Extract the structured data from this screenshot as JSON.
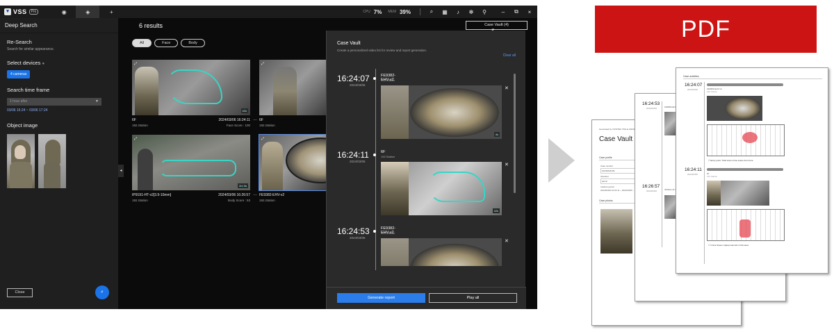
{
  "app": {
    "logo_text": "VSS",
    "pro_badge": "Pro",
    "stats": {
      "cpu_label": "CPU",
      "cpu_value": "7%",
      "mem_label": "MEM",
      "mem_value": "39%"
    },
    "window_controls": {
      "minimize": "–",
      "restore": "⧉",
      "close": "×"
    }
  },
  "sidebar": {
    "title": "Deep Search",
    "re_search": {
      "title": "Re-Search",
      "subtitle": "Search for similar appearance."
    },
    "select_devices": {
      "label": "Select devices",
      "badge": "4 cameras"
    },
    "time_frame": {
      "label": "Search time frame",
      "select_value": "1 hour after",
      "range": "03/06 16:24 ~ 03/06 17:24"
    },
    "object_image_label": "Object image",
    "close_button": "Close",
    "search_fab_icon": "search-icon"
  },
  "main": {
    "results_count": "6 results",
    "filters": [
      "All",
      "Face",
      "Body"
    ],
    "active_filter": "All",
    "case_vault_button": "Case Vault (4)",
    "cards": [
      {
        "cam": "6F",
        "timestamp": "2024/03/06 16:24:11",
        "station": "192.Station",
        "score": "Face Score : 100",
        "badge": "42s"
      },
      {
        "cam": "6F",
        "timestamp": "",
        "station": "192.Station",
        "score": "",
        "badge": ""
      },
      {
        "cam": "IP9191-HT-v2[3.9-10mm]",
        "timestamp": "2024/03/06 16:26:57",
        "station": "192.Station",
        "score": "Body Score : 53",
        "badge": "2m 3s"
      },
      {
        "cam": "FE9382-EHV-v2",
        "timestamp": "",
        "station": "192.Station",
        "score": "",
        "badge": ""
      }
    ]
  },
  "vault": {
    "title": "Case Vault",
    "subtitle": "Create a personalized video list for review and report generation.",
    "clear_all": "Clear all",
    "entries": [
      {
        "time": "16:24:07",
        "date": "2024/03/06",
        "cam": "FE9382-EHV-v2",
        "station": "192.Station",
        "badge": "4s"
      },
      {
        "time": "16:24:11",
        "date": "2024/03/06",
        "cam": "6F",
        "station": "192.Station",
        "badge": "42s"
      },
      {
        "time": "16:24:53",
        "date": "2024/03/06",
        "cam": "FE9382-EHV-v2",
        "station": "192.Station",
        "badge": ""
      }
    ],
    "generate_button": "Generate report",
    "play_all_button": "Play all"
  },
  "pdf": {
    "banner": "PDF",
    "cover": {
      "generated_by": "Generated by VIVOTEK VSS at 2024/03/06",
      "title": "Case Vault - ",
      "case_profile": "Case profile",
      "case_number_label": "Case number",
      "case_number": "20240618109",
      "operator_label": "Operator",
      "operator": "admin",
      "period_label": "Incident period",
      "period": "2024/03/06 16:24:11 ~ 2024/03/06 ...",
      "case_photos": "Case photos"
    },
    "middle": {
      "time1": "16:24:53",
      "date1": "2024/03/06",
      "cam1": "FE9382-EHV-v2",
      "time2": "16:26:57",
      "date2": "2024/03/06",
      "cam2": "IP9191-HT-v2[3.9-10mm]"
    },
    "front": {
      "section": "Case activities",
      "time1": "16:24:07",
      "date1": "2024/03/06",
      "cam1": "FE9382-EHV-v2",
      "station1": "192.Station",
      "note1": "Entry point. Thief enter crime scene from here",
      "time2": "16:24:11",
      "date2": "2024/03/06",
      "cam2": "6F",
      "station2": "192.Station",
      "note2": "Crime Scene: laptop was lost in this area"
    }
  }
}
